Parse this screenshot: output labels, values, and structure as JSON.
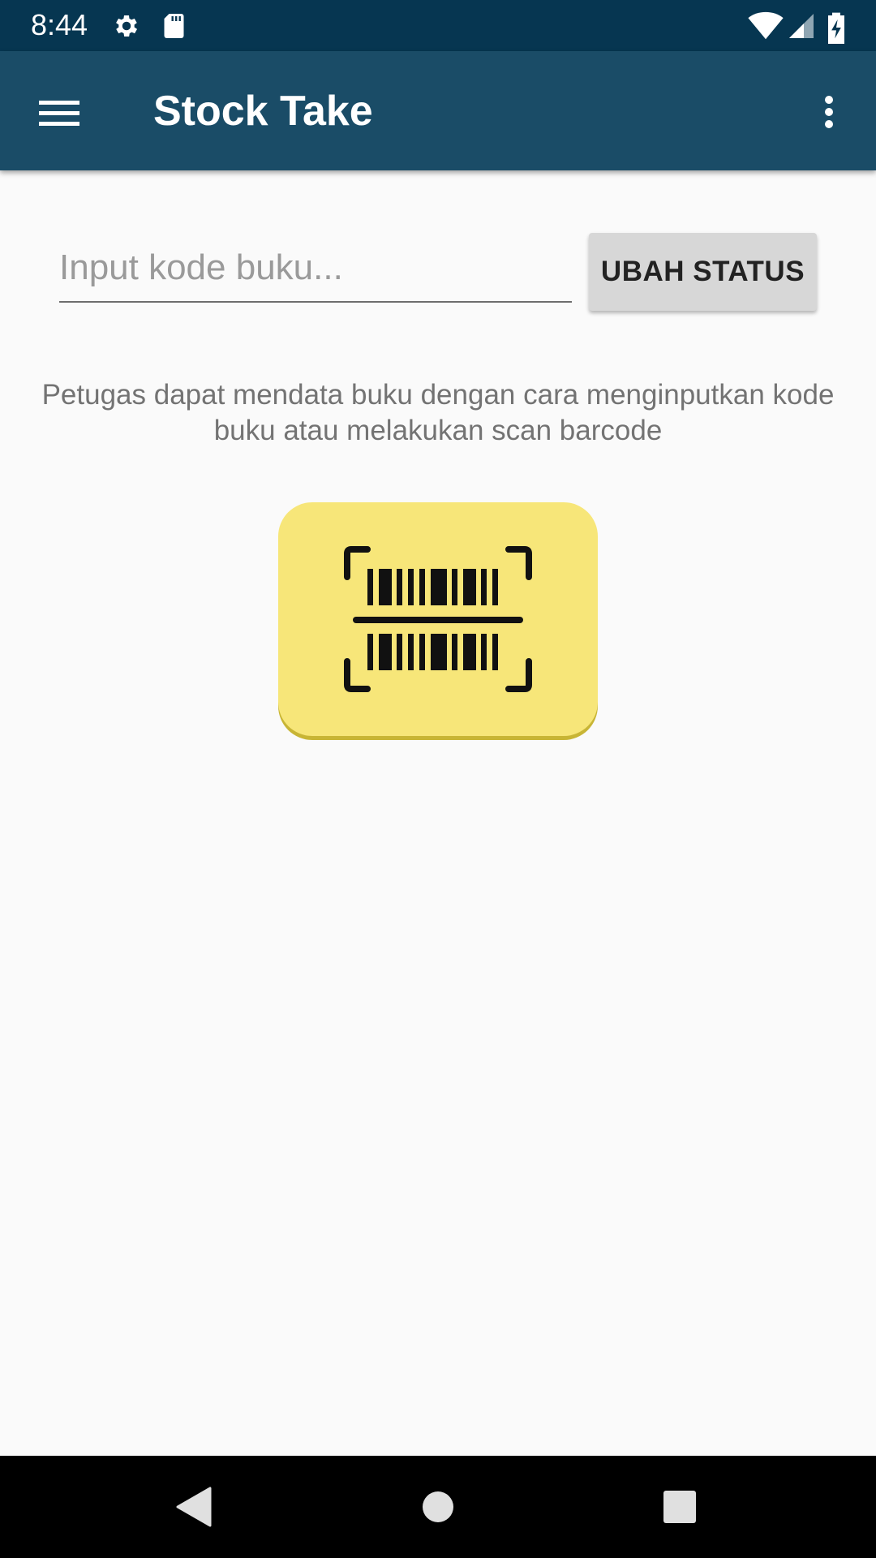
{
  "status_bar": {
    "time": "8:44",
    "icons": [
      "gear-icon",
      "sd-card-icon",
      "wifi-icon",
      "signal-icon",
      "battery-charging-icon"
    ]
  },
  "app_bar": {
    "title": "Stock Take",
    "menu_icon": "hamburger-menu-icon",
    "overflow_icon": "more-vert-icon",
    "color": "#1a4c67"
  },
  "form": {
    "input_placeholder": "Input kode buku...",
    "input_value": "",
    "button_label": "UBAH STATUS"
  },
  "instruction": {
    "text": "Petugas dapat mendata buku dengan cara menginputkan kode buku atau melakukan scan barcode"
  },
  "scan_button": {
    "icon": "barcode-scan-icon",
    "color": "#f7e679"
  },
  "nav_bar": {
    "buttons": [
      "back-icon",
      "home-icon",
      "recents-icon"
    ]
  }
}
